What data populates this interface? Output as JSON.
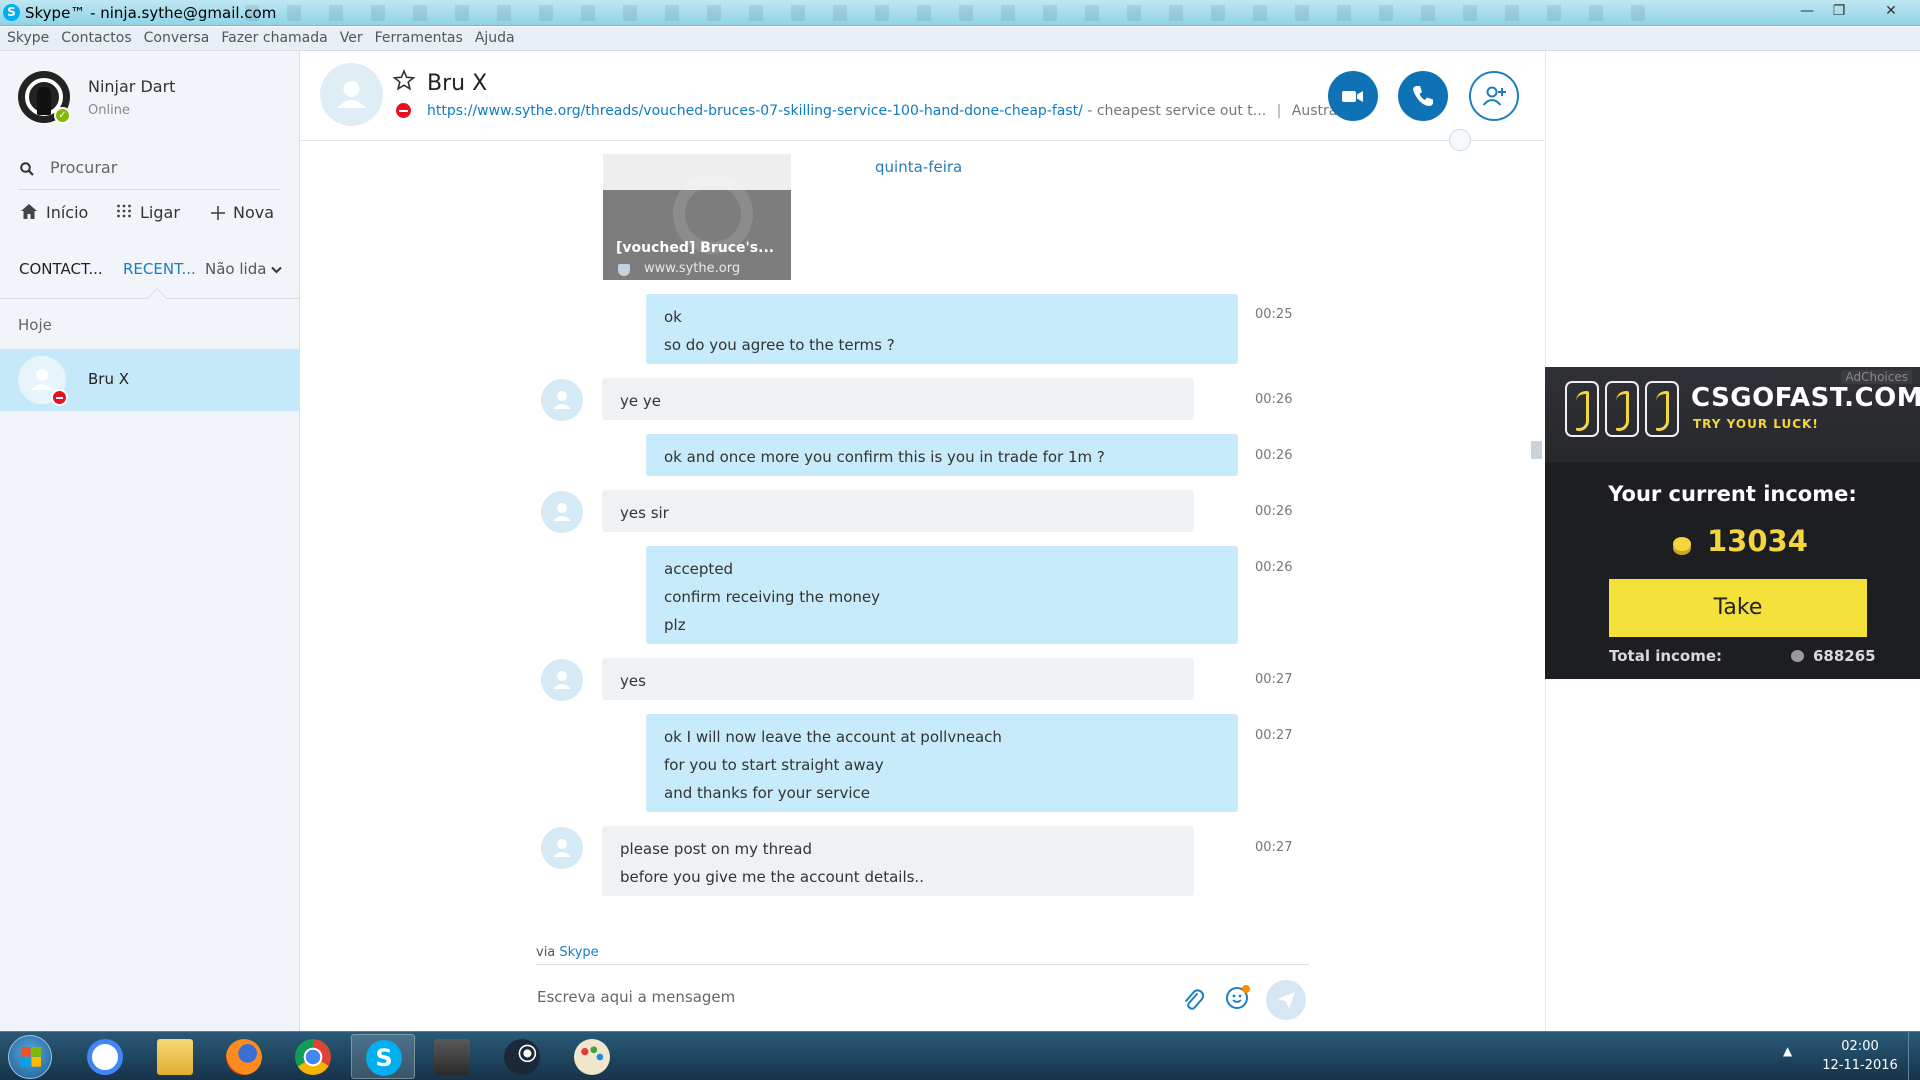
{
  "window": {
    "title": "Skype™ - ninja.sythe@gmail.com",
    "controls": [
      "—",
      "❐",
      "✕"
    ]
  },
  "menu": [
    "Skype",
    "Contactos",
    "Conversa",
    "Fazer chamada",
    "Ver",
    "Ferramentas",
    "Ajuda"
  ],
  "profile": {
    "name": "Ninjar Dart",
    "status": "Online"
  },
  "search": {
    "placeholder": "Procurar"
  },
  "nav": {
    "home": "Início",
    "call": "Ligar",
    "new": "Nova"
  },
  "tabs": {
    "contacts": "CONTACT...",
    "recent": "RECENT...",
    "unread": "Não lida"
  },
  "recent_section": "Hoje",
  "contacts": [
    {
      "name": "Bru X",
      "status": "busy"
    }
  ],
  "chat": {
    "name": "Bru X",
    "mood_link": "https://www.sythe.org/threads/vouched-bruces-07-skilling-service-100-hand-done-cheap-fast/",
    "mood_text": "- cheapest service out t...",
    "location": "Austrália",
    "day_separator": "quinta-feira",
    "link_preview": {
      "title": "[vouched] Bruce's...",
      "domain": "www.sythe.org"
    },
    "messages": [
      {
        "dir": "out",
        "lines": [
          "ok",
          "so do you agree to the terms ?"
        ],
        "time": "00:25"
      },
      {
        "dir": "in",
        "lines": [
          "ye ye"
        ],
        "time": "00:26"
      },
      {
        "dir": "out",
        "lines": [
          "ok and once more you confirm this is you in trade for 1m ?"
        ],
        "time": "00:26"
      },
      {
        "dir": "in",
        "lines": [
          "yes sir"
        ],
        "time": "00:26"
      },
      {
        "dir": "out",
        "lines": [
          "accepted",
          "confirm receiving the money",
          "plz"
        ],
        "time": "00:26"
      },
      {
        "dir": "in",
        "lines": [
          "yes"
        ],
        "time": "00:27"
      },
      {
        "dir": "out",
        "lines": [
          "ok I will now leave the account at pollvneach",
          "for you to start straight away",
          "and thanks for your service"
        ],
        "time": "00:27"
      },
      {
        "dir": "in",
        "lines": [
          "please post on my thread",
          "before you give me the account details.."
        ],
        "time": "00:27"
      }
    ],
    "via_prefix": "via",
    "via_app": "Skype",
    "composer_placeholder": "Escreva aqui a mensagem"
  },
  "ad": {
    "choices": "AdChoices",
    "brand": "CSGOFAST.COM",
    "tagline": "TRY YOUR LUCK!",
    "income_label": "Your current income:",
    "income_value": "13034",
    "button": "Take",
    "total_label": "Total income:",
    "total_value": "688265",
    "colors": {
      "accent": "#f4e139",
      "background": "#1d1e22"
    }
  },
  "taskbar": {
    "apps": [
      "google-icon",
      "folder-icon",
      "firefox-icon",
      "chrome-icon",
      "skype-icon",
      "world-of-tanks-icon",
      "steam-icon",
      "paint-icon"
    ],
    "active_app": "skype-icon",
    "time": "02:00",
    "date": "12-11-2016"
  },
  "colors": {
    "outgoing_bubble": "#c7ebfb",
    "incoming_bubble": "#eff2f5",
    "selected_contact": "#c5e9f8",
    "skype_blue": "#0f72b5"
  }
}
